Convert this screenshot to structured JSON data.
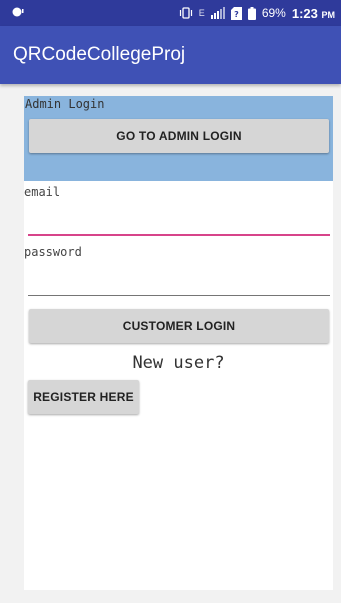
{
  "status_bar": {
    "battery": "69%",
    "time": "1:23",
    "time_suffix": "PM",
    "network": "E"
  },
  "app_bar": {
    "title": "QRCodeCollegeProj"
  },
  "admin": {
    "label": "Admin Login",
    "button_label": "GO TO ADMIN LOGIN"
  },
  "login_form": {
    "email_label": "email",
    "email_value": "",
    "password_label": "password",
    "password_value": "",
    "customer_button_label": "CUSTOMER LOGIN"
  },
  "register": {
    "prompt": "New user?",
    "button_label": "REGISTER HERE"
  },
  "colors": {
    "status_bar": "#2f3a9b",
    "app_bar": "#3f51b5",
    "admin_section": "#89b4dd",
    "email_underline": "#d7448a",
    "button": "#d6d6d6"
  }
}
